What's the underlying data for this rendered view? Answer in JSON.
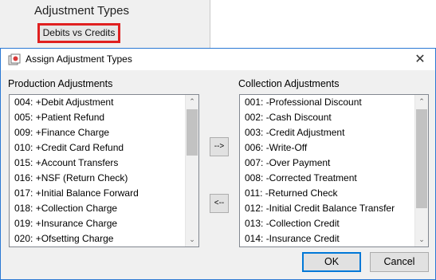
{
  "background": {
    "header": "Adjustment Types",
    "button_label": "Debits vs Credits"
  },
  "dialog": {
    "title": "Assign Adjustment Types",
    "close_glyph": "✕",
    "production_label": "Production Adjustments",
    "collection_label": "Collection Adjustments",
    "production_items": [
      "004: +Debit Adjustment",
      "005: +Patient Refund",
      "009: +Finance Charge",
      "010: +Credit Card Refund",
      "015: +Account Transfers",
      "016: +NSF (Return Check)",
      "017: +Initial Balance Forward",
      "018: +Collection Charge",
      "019: +Insurance Charge",
      "020: +Ofsetting Charge"
    ],
    "collection_items": [
      "001: -Professional Discount",
      "002: -Cash Discount",
      "003: -Credit Adjustment",
      "006: -Write-Off",
      "007: -Over Payment",
      "008: -Corrected Treatment",
      "011: -Returned Check",
      "012: -Initial Credit Balance Transfer",
      "013: -Collection Credit",
      "014: -Insurance Credit"
    ],
    "move_right_label": "-->",
    "move_left_label": "<--",
    "ok_label": "OK",
    "cancel_label": "Cancel"
  },
  "colors": {
    "accent": "#0078d7",
    "highlight_border": "#e02020"
  },
  "icons": {
    "app": "app-icon",
    "close": "close-icon",
    "scroll_up": "chevron-up-icon",
    "scroll_down": "chevron-down-icon"
  }
}
